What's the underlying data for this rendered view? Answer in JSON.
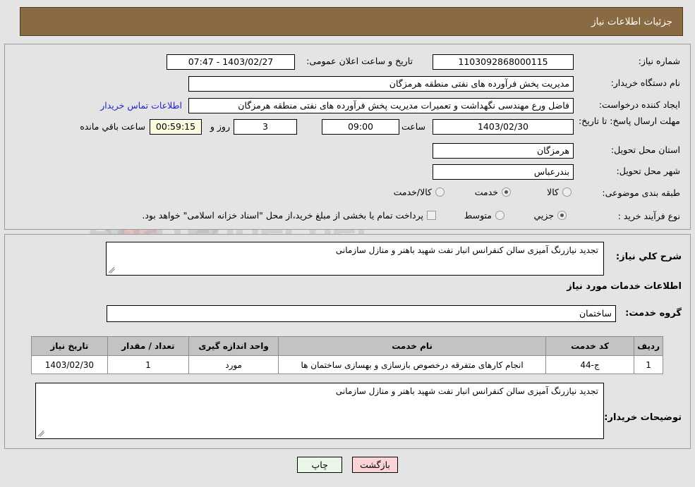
{
  "header": {
    "title": "جزئیات اطلاعات نیاز"
  },
  "watermark": {
    "text": "AriaTender.net"
  },
  "top_form": {
    "need_number": {
      "label": "شماره نیاز:",
      "value": "1103092868000115"
    },
    "announce_datetime": {
      "label": "تاریخ و ساعت اعلان عمومی:",
      "value": "1403/02/27 - 07:47"
    },
    "buyer_org": {
      "label": "نام دستگاه خریدار:",
      "value": "مدیریت پخش فرآورده های نفتی منطقه هرمزگان"
    },
    "requester": {
      "label": "ایجاد کننده درخواست:",
      "value": "فاضل ورع مهندسی نگهداشت و تعمیرات مدیریت پخش فرآورده های نفتی منطقه هرمزگان"
    },
    "contact_link": "اطلاعات تماس خریدار",
    "deadline": {
      "label": "مهلت ارسال پاسخ: تا تاریخ:",
      "date": "1403/02/30",
      "time_label": "ساعت",
      "time": "09:00",
      "days": "3",
      "days_label": "روز و",
      "countdown": "00:59:15",
      "countdown_label": "ساعت باقي مانده"
    },
    "province": {
      "label": "استان محل تحویل:",
      "value": "هرمزگان"
    },
    "city": {
      "label": "شهر محل تحویل:",
      "value": "بندرعباس"
    },
    "category": {
      "label": "طبقه بندی موضوعی:",
      "options": [
        "کالا",
        "خدمت",
        "کالا/خدمت"
      ],
      "selected": "خدمت"
    },
    "process_type": {
      "label": "نوع فرآیند خرید :",
      "options": [
        "جزیي",
        "متوسط"
      ],
      "selected": "جزیي",
      "checkbox_label": "پرداخت تمام یا بخشی از مبلغ خرید،از محل \"اسناد خزانه اسلامی\" خواهد بود.",
      "checkbox_checked": false
    }
  },
  "mid": {
    "need_summary": {
      "label": "شرح کلي نیاز:",
      "value": "تجدید نیازرنگ آمیزی سالن کنفرانس انبار  نفت شهید باهنر و منازل سازمانی"
    },
    "services_heading": "اطلاعات خدمات مورد نیاز",
    "service_group": {
      "label": "گروه خدمت:",
      "value": "ساختمان"
    },
    "table": {
      "columns": [
        "ردیف",
        "کد خدمت",
        "نام خدمت",
        "واحد اندازه گیری",
        "تعداد / مقدار",
        "تاریخ نیاز"
      ],
      "rows": [
        {
          "row": "1",
          "code": "ج-44",
          "name": "انجام کارهای متفرقه درخصوص بازسازی و بهسازی ساختمان ها",
          "unit": "مورد",
          "qty": "1",
          "need_date": "1403/02/30"
        }
      ]
    },
    "buyer_notes": {
      "label": "توضیحات خریدار:",
      "value": "تجدید نیازرنگ آمیزی سالن کنفرانس انبار  نفت شهید باهنر و منازل سازمانی"
    }
  },
  "buttons": {
    "print": "چاپ",
    "back": "بازگشت"
  }
}
